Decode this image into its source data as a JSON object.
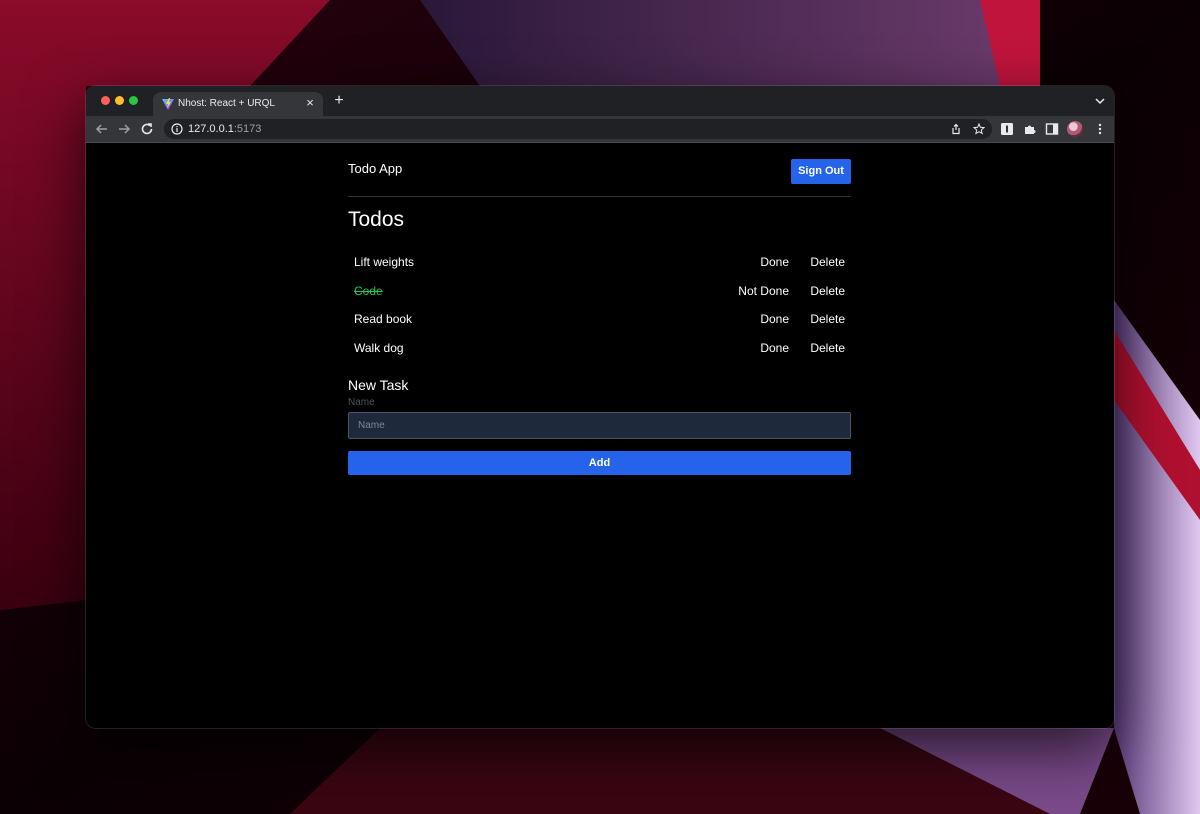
{
  "browser": {
    "tab_title": "Nhost: React + URQL",
    "tab_close": "×",
    "new_tab": "+",
    "url_host": "127.0.0.1",
    "url_port": ":5173"
  },
  "app": {
    "brand": "Todo App",
    "sign_out_label": "Sign Out",
    "heading": "Todos",
    "todos": [
      {
        "label": "Lift weights",
        "completed": false,
        "toggle_label": "Done",
        "delete_label": "Delete"
      },
      {
        "label": "Code",
        "completed": true,
        "toggle_label": "Not Done",
        "delete_label": "Delete"
      },
      {
        "label": "Read book",
        "completed": false,
        "toggle_label": "Done",
        "delete_label": "Delete"
      },
      {
        "label": "Walk dog",
        "completed": false,
        "toggle_label": "Done",
        "delete_label": "Delete"
      }
    ],
    "new_task": {
      "title": "New Task",
      "field_label": "Name",
      "placeholder": "Name",
      "value": "",
      "add_label": "Add"
    }
  },
  "colors": {
    "accent": "#2563eb",
    "completed_text": "#22c55e",
    "page_background": "#000000"
  }
}
